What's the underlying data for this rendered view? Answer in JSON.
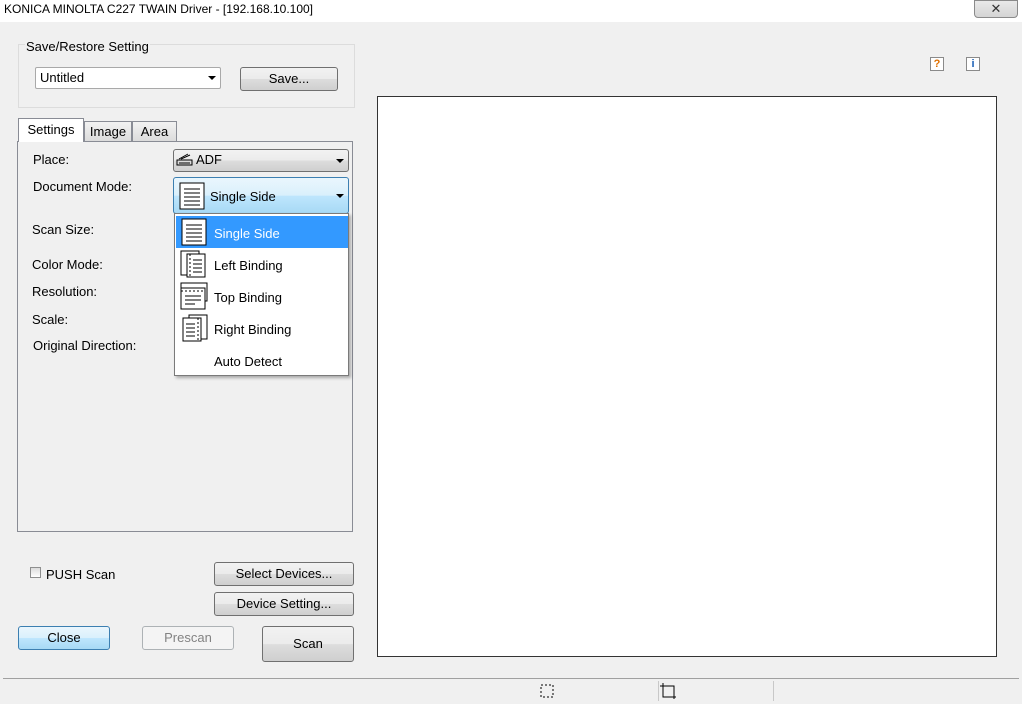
{
  "window": {
    "title": "KONICA MINOLTA C227 TWAIN Driver - [192.168.10.100]",
    "close_glyph": "✕"
  },
  "save_restore": {
    "group_label": "Save/Restore Setting",
    "selected": "Untitled",
    "save_button": "Save..."
  },
  "help_icons": {
    "help_glyph": "?",
    "info_glyph": "i",
    "help_color": "#e07000",
    "info_color": "#1a5fb4"
  },
  "tabs": [
    {
      "label": "Settings",
      "active": true
    },
    {
      "label": "Image",
      "active": false
    },
    {
      "label": "Area",
      "active": false
    }
  ],
  "settings": {
    "place_label": "Place:",
    "place_value": "ADF",
    "document_mode_label": "Document Mode:",
    "document_mode_value": "Single Side",
    "scan_size_label": "Scan Size:",
    "color_mode_label": "Color Mode:",
    "resolution_label": "Resolution:",
    "scale_label": "Scale:",
    "original_direction_label": "Original Direction:"
  },
  "document_mode_options": [
    {
      "label": "Single Side",
      "icon": "single-side-icon",
      "selected": true
    },
    {
      "label": "Left Binding",
      "icon": "left-binding-icon",
      "selected": false
    },
    {
      "label": "Top Binding",
      "icon": "top-binding-icon",
      "selected": false
    },
    {
      "label": "Right Binding",
      "icon": "right-binding-icon",
      "selected": false
    },
    {
      "label": "Auto Detect",
      "icon": "",
      "selected": false
    }
  ],
  "bottom": {
    "push_scan_label": "PUSH Scan",
    "push_scan_checked": false,
    "select_devices_button": "Select Devices...",
    "device_setting_button": "Device Setting...",
    "close_button": "Close",
    "prescan_button": "Prescan",
    "scan_button": "Scan"
  },
  "colors": {
    "selection": "#3399ff",
    "window_bg": "#f0f0f0"
  }
}
